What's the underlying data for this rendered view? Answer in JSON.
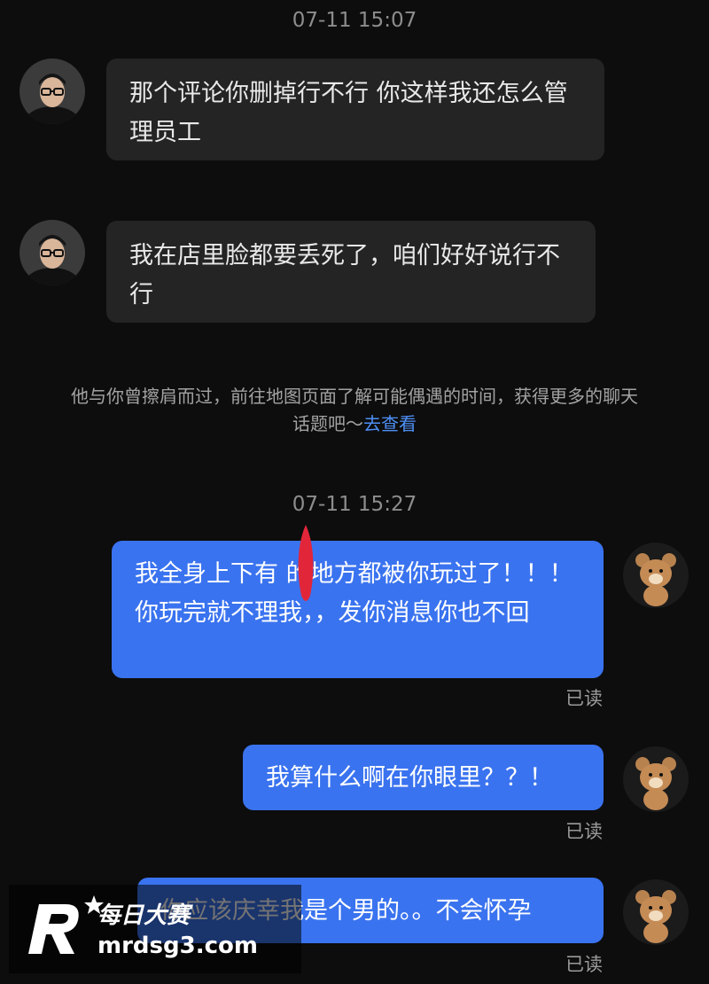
{
  "conversation": {
    "time_1": "07-11 15:07",
    "time_2": "07-11 15:27",
    "incoming": [
      "那个评论你删掉行不行 你这样我还怎么管理员工",
      "我在店里脸都要丢死了，咱们好好说行不行"
    ],
    "system_notice": "他与你曾擦肩而过，前往地图页面了解可能偶遇的时间，获得更多的聊天话题吧～",
    "system_link": "去查看",
    "outgoing": [
      "我全身上下有 的地方都被你玩过了！！！你玩完就不理我，，发你消息你也不回",
      "我算什么啊在你眼里？？！",
      "你应该庆幸我是个男的。。不会怀孕"
    ],
    "read_label": "已读"
  },
  "watermark": {
    "brand": "每日大赛",
    "url": "mrdsg3.com"
  },
  "colors": {
    "background": "#0d0d0d",
    "incoming_bubble": "#242424",
    "outgoing_bubble": "#3a73ef",
    "link": "#4d8ff5"
  }
}
